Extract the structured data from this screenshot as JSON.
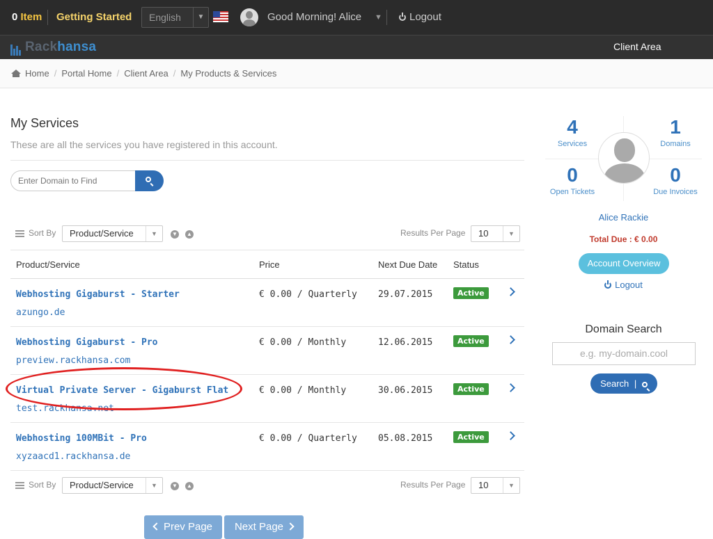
{
  "topbar": {
    "cart_count": "0",
    "cart_label": "Item",
    "getting_started": "Getting Started",
    "language": "English",
    "greeting": "Good Morning! Alice",
    "logout": "Logout",
    "flag_icon": "us-flag-icon"
  },
  "navbar": {
    "logo_part1": "Rack",
    "logo_part2": "hansa",
    "client_area": "Client Area"
  },
  "breadcrumb": [
    "Home",
    "Portal Home",
    "Client Area",
    "My Products & Services"
  ],
  "main": {
    "title": "My Services",
    "subtitle": "These are all the services you have registered in this account.",
    "search_placeholder": "Enter Domain to Find",
    "sort_label": "Sort By",
    "sort_value": "Product/Service",
    "results_per_page_label": "Results Per Page",
    "results_per_page_value": "10"
  },
  "table": {
    "headers": [
      "Product/Service",
      "Price",
      "Next Due Date",
      "Status"
    ],
    "rows": [
      {
        "name": "Webhosting Gigaburst - Starter",
        "domain": "azungo.de",
        "price": "€ 0.00 / Quarterly",
        "due": "29.07.2015",
        "status": "Active"
      },
      {
        "name": "Webhosting Gigaburst - Pro",
        "domain": "preview.rackhansa.com",
        "price": "€ 0.00 / Monthly",
        "due": "12.06.2015",
        "status": "Active"
      },
      {
        "name": "Virtual Private Server - Gigaburst Flat",
        "domain": "test.rackhansa.net",
        "price": "€ 0.00 / Monthly",
        "due": "30.06.2015",
        "status": "Active"
      },
      {
        "name": "Webhosting 100MBit - Pro",
        "domain": "xyzaacd1.rackhansa.de",
        "price": "€ 0.00 / Quarterly",
        "due": "05.08.2015",
        "status": "Active"
      }
    ]
  },
  "pager": {
    "prev": "Prev Page",
    "next": "Next Page"
  },
  "sidebar": {
    "stats": [
      {
        "value": "4",
        "label": "Services"
      },
      {
        "value": "1",
        "label": "Domains"
      },
      {
        "value": "0",
        "label": "Open Tickets"
      },
      {
        "value": "0",
        "label": "Due Invoices"
      }
    ],
    "user_name": "Alice Rackie",
    "total_due": "Total Due : € 0.00",
    "account_overview": "Account Overview",
    "logout": "Logout",
    "domain_search_title": "Domain Search",
    "domain_search_placeholder": "e.g. my-domain.cool",
    "domain_search_button": "Search",
    "domain_search_separator": "|"
  },
  "colors": {
    "accent": "#2f72b8",
    "status_active": "#3c9a3c",
    "annotation": "#e02020"
  }
}
